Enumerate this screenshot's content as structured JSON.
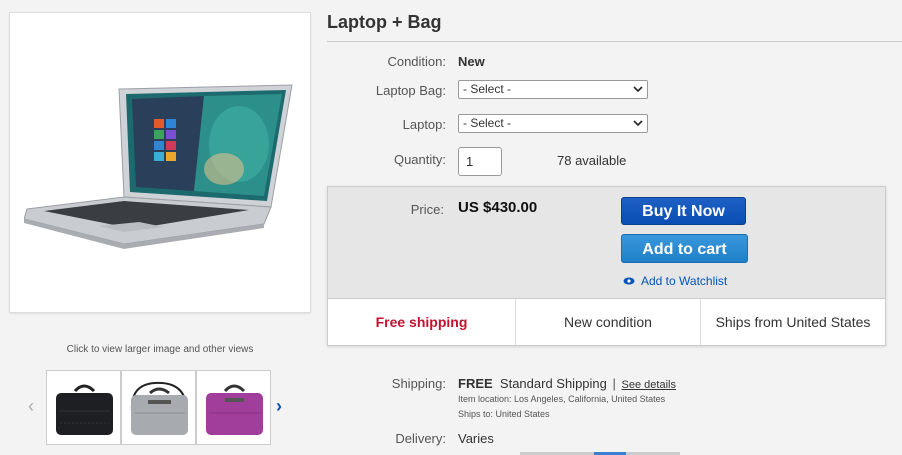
{
  "gallery": {
    "caption": "Click to view larger image and other views",
    "prev_icon": "chevron-left-icon",
    "next_icon": "chevron-right-icon",
    "thumbnails": [
      "black laptop bag",
      "grey laptop bag",
      "purple laptop bag"
    ]
  },
  "product": {
    "title": "Laptop + Bag"
  },
  "details": {
    "condition_label": "Condition:",
    "condition_value": "New",
    "laptop_bag_label": "Laptop Bag:",
    "laptop_bag_value": "- Select -",
    "laptop_label": "Laptop:",
    "laptop_value": "- Select -",
    "quantity_label": "Quantity:",
    "quantity_value": "1",
    "available_text": "78 available"
  },
  "price": {
    "label": "Price:",
    "value": "US $430.00",
    "buy_now": "Buy It Now",
    "add_to_cart": "Add to cart",
    "watchlist": "Add to Watchlist"
  },
  "features": [
    "Free shipping",
    "New condition",
    "Ships from United States"
  ],
  "shipping": {
    "label": "Shipping:",
    "free": "FREE",
    "method": "Standard Shipping",
    "separator": "|",
    "see_details": "See details",
    "item_location": "Item location:  Los Angeles, California, United States",
    "ships_to": "Ships to:  United States"
  },
  "delivery": {
    "label": "Delivery:",
    "value": "Varies"
  },
  "colors": {
    "buy_now": "#0a4eb3",
    "add_to_cart": "#1f80c8",
    "free_shipping": "#c41230",
    "link": "#0654ba"
  }
}
